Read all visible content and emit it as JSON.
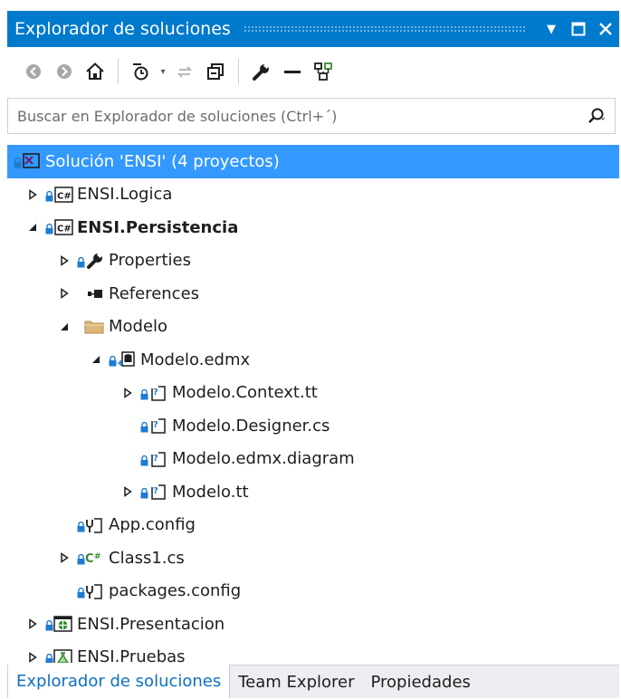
{
  "window": {
    "title": "Explorador de soluciones",
    "dropdown_glyph": "▼",
    "maximize_glyph": "☐",
    "close_glyph": "✕"
  },
  "toolbar": {
    "icons": [
      "back-icon",
      "forward-icon",
      "home-icon",
      "pending-changes-icon",
      "sync-icon",
      "collapse-all-icon",
      "properties-wrench-icon",
      "minus-icon",
      "view-class-diagram-icon"
    ]
  },
  "search": {
    "placeholder": "Buscar en Explorador de soluciones (Ctrl+´)",
    "value": ""
  },
  "tree": {
    "items": [
      {
        "label": "Solución 'ENSI'  (4 proyectos)",
        "level": 0,
        "expander": "none",
        "icon": "solution-icon",
        "selected": true,
        "bold": false
      },
      {
        "label": "ENSI.Logica",
        "level": 1,
        "expander": "collapsed",
        "icon": "csharp-project-icon",
        "selected": false,
        "bold": false
      },
      {
        "label": "ENSI.Persistencia",
        "level": 1,
        "expander": "expanded",
        "icon": "csharp-project-icon",
        "selected": false,
        "bold": true
      },
      {
        "label": "Properties",
        "level": 2,
        "expander": "collapsed",
        "icon": "wrench-icon",
        "selected": false,
        "bold": false
      },
      {
        "label": "References",
        "level": 2,
        "expander": "collapsed",
        "icon": "references-icon",
        "selected": false,
        "bold": false
      },
      {
        "label": "Modelo",
        "level": 2,
        "expander": "expanded",
        "icon": "folder-icon",
        "selected": false,
        "bold": false
      },
      {
        "label": "Modelo.edmx",
        "level": 3,
        "expander": "expanded",
        "icon": "edmx-icon",
        "selected": false,
        "bold": false
      },
      {
        "label": "Modelo.Context.tt",
        "level": 4,
        "expander": "collapsed",
        "icon": "text-template-icon",
        "selected": false,
        "bold": false
      },
      {
        "label": "Modelo.Designer.cs",
        "level": 4,
        "expander": "none",
        "icon": "text-template-icon",
        "selected": false,
        "bold": false
      },
      {
        "label": "Modelo.edmx.diagram",
        "level": 4,
        "expander": "none",
        "icon": "text-template-icon",
        "selected": false,
        "bold": false
      },
      {
        "label": "Modelo.tt",
        "level": 4,
        "expander": "collapsed",
        "icon": "text-template-icon",
        "selected": false,
        "bold": false
      },
      {
        "label": "App.config",
        "level": 2,
        "expander": "none",
        "icon": "config-icon",
        "selected": false,
        "bold": false
      },
      {
        "label": "Class1.cs",
        "level": 2,
        "expander": "collapsed",
        "icon": "csharp-file-icon",
        "selected": false,
        "bold": false
      },
      {
        "label": "packages.config",
        "level": 2,
        "expander": "none",
        "icon": "config-icon",
        "selected": false,
        "bold": false
      },
      {
        "label": "ENSI.Presentacion",
        "level": 1,
        "expander": "collapsed",
        "icon": "web-project-icon",
        "selected": false,
        "bold": false
      },
      {
        "label": "ENSI.Pruebas",
        "level": 1,
        "expander": "collapsed",
        "icon": "test-project-icon",
        "selected": false,
        "bold": false
      }
    ]
  },
  "tabs": [
    {
      "label": "Explorador de soluciones",
      "active": true
    },
    {
      "label": "Team Explorer",
      "active": false
    },
    {
      "label": "Propiedades",
      "active": false
    }
  ],
  "colors": {
    "accent": "#007acc",
    "selection": "#3399ff",
    "lock": "#1e7bd0",
    "csharp_green": "#388a34",
    "folder": "#dcb67a"
  }
}
